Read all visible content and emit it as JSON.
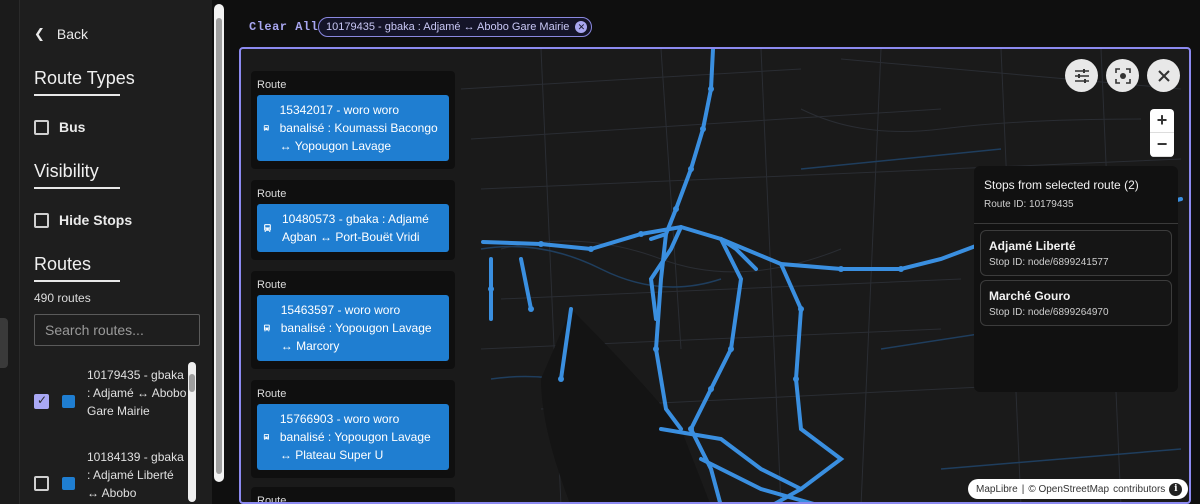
{
  "sidebar": {
    "back_label": "Back",
    "route_types_title": "Route Types",
    "bus_label": "Bus",
    "visibility_title": "Visibility",
    "hide_stops_label": "Hide Stops",
    "routes_title": "Routes",
    "route_count": "490 routes",
    "search_placeholder": "Search routes...",
    "routes": [
      {
        "label": "10179435 - gbaka : Adjamé ↔ Abobo Gare Mairie",
        "checked": true,
        "color": "#1f7ed1"
      },
      {
        "label": "10184139 - gbaka : Adjamé Liberté ↔ Abobo",
        "checked": false,
        "color": "#1f7ed1"
      }
    ]
  },
  "topbar": {
    "clear_all": "Clear All",
    "chip_label": "10179435 - gbaka : Adjamé ↔ Abobo Gare Mairie"
  },
  "map": {
    "route_cards": [
      {
        "heading": "Route",
        "text": "15342017 - woro woro banalisé : Koumassi Bacongo ↔ Yopougon Lavage"
      },
      {
        "heading": "Route",
        "text": "10480573 - gbaka : Adjamé Agban ↔ Port-Bouët Vridi"
      },
      {
        "heading": "Route",
        "text": "15463597 - woro woro banalisé : Yopougon Lavage ↔ Marcory"
      },
      {
        "heading": "Route",
        "text": "15766903 - woro woro banalisé : Yopougon Lavage ↔ Plateau Super U"
      },
      {
        "heading": "Route",
        "text": ""
      }
    ],
    "stops_panel": {
      "title": "Stops from selected route (2)",
      "route_id": "Route ID: 10179435",
      "stops": [
        {
          "name": "Adjamé Liberté",
          "id": "Stop ID: node/6899241577"
        },
        {
          "name": "Marché Gouro",
          "id": "Stop ID: node/6899264970"
        }
      ]
    },
    "zoom_in": "+",
    "zoom_out": "−",
    "attribution": {
      "maplibre": "MapLibre",
      "separator": "|",
      "copyright": "© OpenStreetMap",
      "contributors": "contributors",
      "info": "i"
    },
    "icons": [
      "filters-icon",
      "recenter-icon",
      "close-icon",
      "bus-icon"
    ],
    "colors": {
      "route": "#1f7ed1",
      "route_line": "#3a8fe0",
      "accent": "#8c8af0",
      "map_bg": "#1a1a1a"
    }
  }
}
